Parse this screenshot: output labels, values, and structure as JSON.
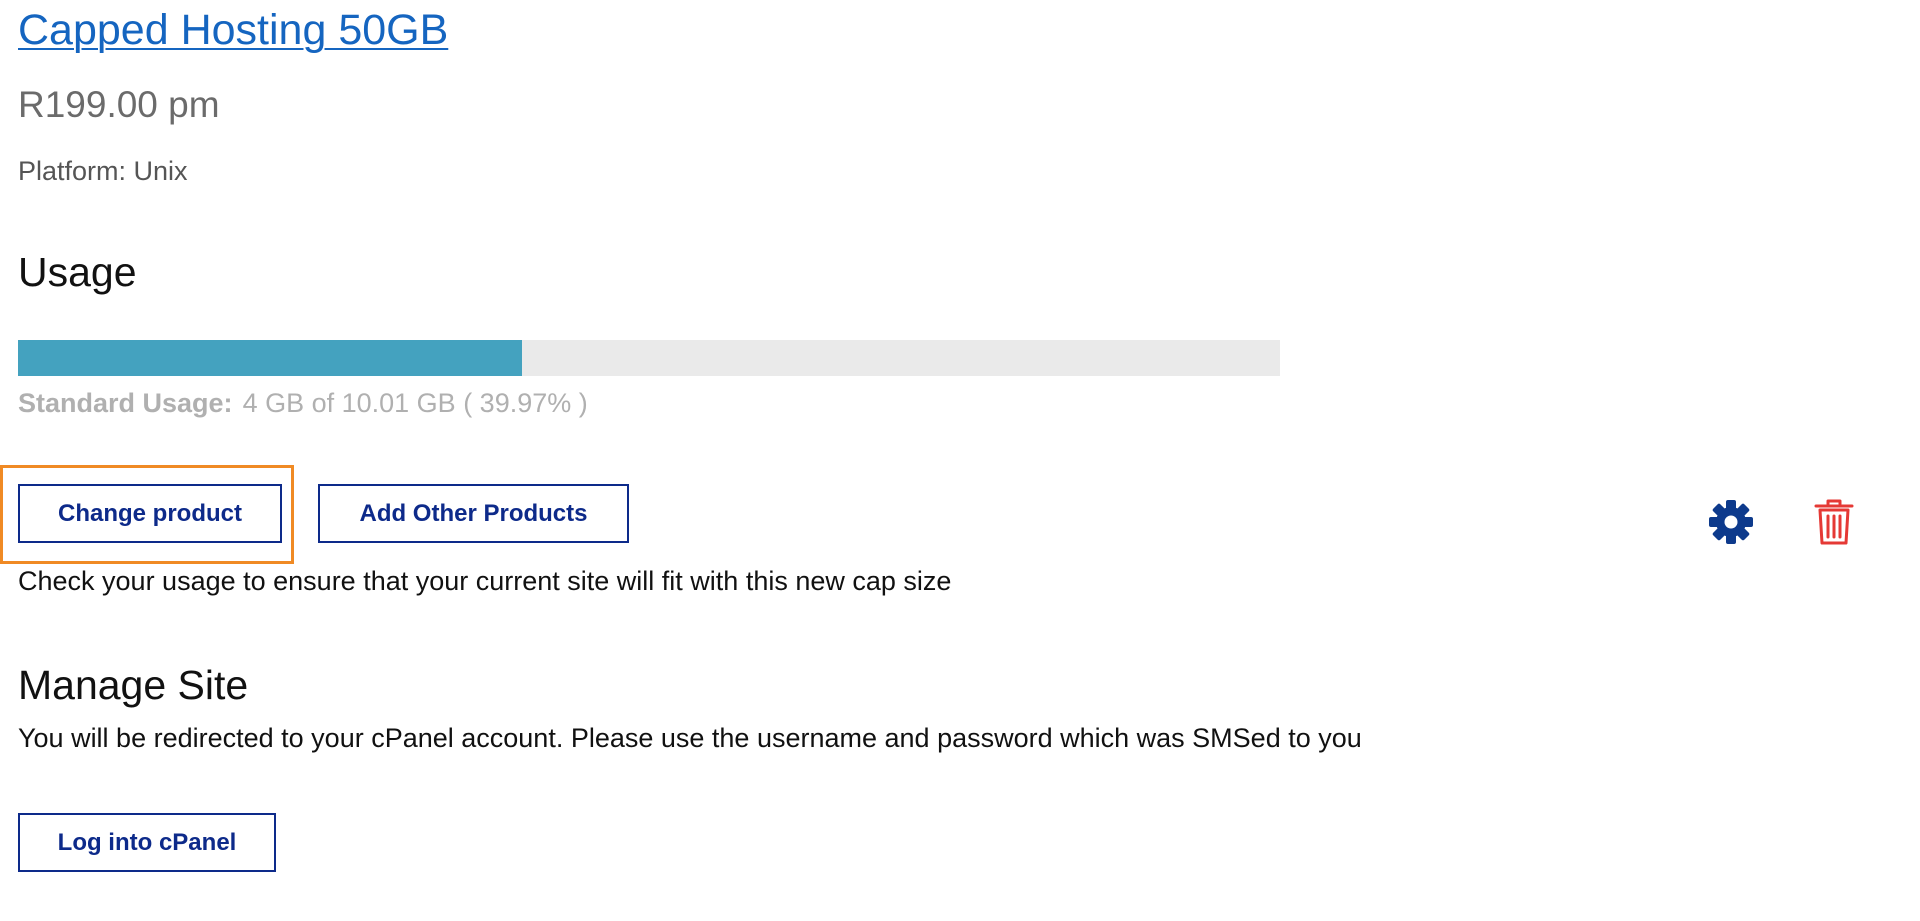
{
  "product": {
    "title": "Capped Hosting 50GB",
    "price": "R199.00 pm",
    "platform": "Platform: Unix"
  },
  "usage": {
    "heading": "Usage",
    "percent": 39.97,
    "label": "Standard Usage:",
    "value_text": "4 GB of 10.01 GB ( 39.97% )",
    "bar_color": "#44a2bf",
    "track_color": "#eaeaea"
  },
  "actions": {
    "change_product_label": "Change product",
    "add_other_products_label": "Add Other Products",
    "hint": "Check your usage to ensure that your current site will fit with this new cap size",
    "settings_icon": "gear-icon",
    "delete_icon": "trash-icon",
    "settings_color": "#0d3a8c",
    "delete_color": "#e53935"
  },
  "manage_site": {
    "heading": "Manage Site",
    "description": "You will be redirected to your cPanel account. Please use the username and password which was SMSed to you",
    "login_label": "Log into cPanel"
  },
  "colors": {
    "link": "#1565c0",
    "button_border": "#0d2a8a",
    "focus_outline": "#f08a24"
  }
}
